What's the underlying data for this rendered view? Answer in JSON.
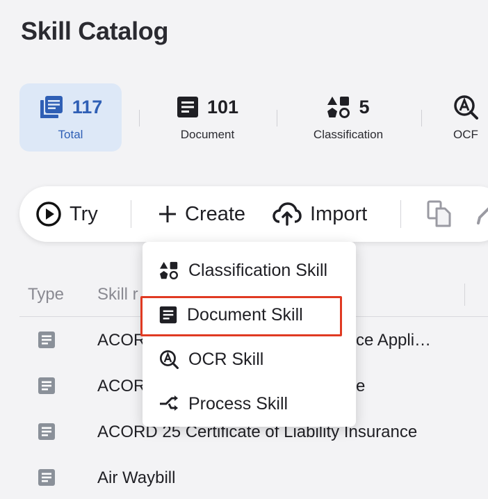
{
  "page": {
    "title": "Skill Catalog"
  },
  "stats": {
    "total": {
      "value": "117",
      "label": "Total"
    },
    "document": {
      "value": "101",
      "label": "Document"
    },
    "classification": {
      "value": "5",
      "label": "Classification"
    },
    "ocr": {
      "value": "",
      "label": "OCF"
    }
  },
  "toolbar": {
    "try_label": "Try",
    "create_label": "Create",
    "import_label": "Import",
    "icons": [
      "play-circle-icon",
      "plus-icon",
      "cloud-upload-icon",
      "copy-icon",
      "edit-icon"
    ]
  },
  "table": {
    "columns": [
      "Type",
      "Skill r"
    ],
    "rows": [
      {
        "name": "ACORD",
        "tail": "ce Appli…"
      },
      {
        "name": "ACORD",
        "tail": "e"
      },
      {
        "name": "ACORD 25 Certificate of Liability Insurance",
        "tail": ""
      },
      {
        "name": "Air Waybill",
        "tail": ""
      }
    ]
  },
  "create_menu": {
    "items": [
      {
        "label": "Classification Skill",
        "icon": "shapes-icon"
      },
      {
        "label": "Document Skill",
        "icon": "document-icon"
      },
      {
        "label": "OCR Skill",
        "icon": "ocr-icon"
      },
      {
        "label": "Process Skill",
        "icon": "process-icon"
      }
    ],
    "highlighted_item": "Document Skill"
  },
  "colors": {
    "accent": "#2f5fb5",
    "accent_bg": "#dde8f7",
    "highlight_border": "#e03a22",
    "row_icon": "#8a9099"
  }
}
